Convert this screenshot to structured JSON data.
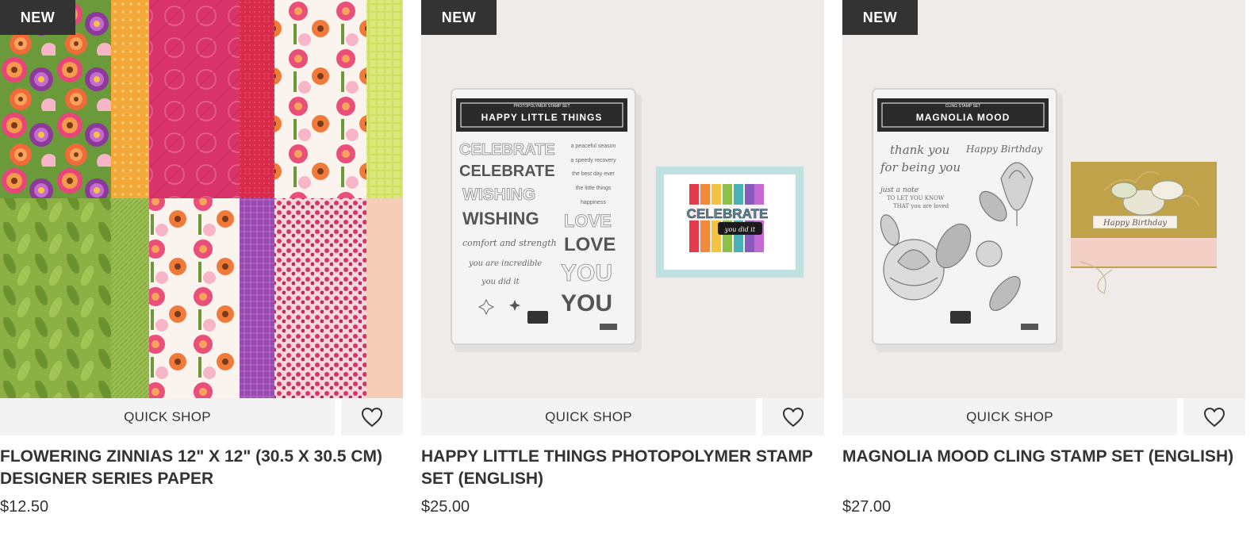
{
  "products": [
    {
      "badge": "NEW",
      "quick_shop_label": "QUICK SHOP",
      "title": "FLOWERING ZINNIAS 12\" X 12\" (30.5 X 30.5 CM) DESIGNER SERIES PAPER",
      "price": "$12.50"
    },
    {
      "badge": "NEW",
      "quick_shop_label": "QUICK SHOP",
      "title": "HAPPY LITTLE THINGS PHOTOPOLYMER STAMP SET (ENGLISH)",
      "price": "$25.00",
      "image_text": {
        "package_title": "HAPPY LITTLE THINGS",
        "package_subtitle": "PHOTOPOLYMER STAMP SET",
        "stamp_words": [
          "CELEBRATE",
          "CELEBRATE",
          "WISHING",
          "WISHING"
        ],
        "stamp_script": [
          "comfort and strength",
          "you are incredible",
          "you did it"
        ],
        "stamp_small": [
          "a peaceful season",
          "a speedy recovery",
          "the best day ever",
          "the little things",
          "happiness"
        ],
        "stamp_words_right": [
          "LOVE",
          "LOVE",
          "YOU",
          "YOU"
        ],
        "card_word": "CELEBRATE",
        "card_script": "you did it"
      }
    },
    {
      "badge": "NEW",
      "quick_shop_label": "QUICK SHOP",
      "title": "MAGNOLIA MOOD CLING STAMP SET (ENGLISH)",
      "price": "$27.00",
      "image_text": {
        "package_title": "MAGNOLIA MOOD",
        "package_subtitle": "CLING STAMP SET",
        "stamp_script": [
          "thank you",
          "for being you",
          "Happy Birthday",
          "just a note"
        ],
        "stamp_small": [
          "TO LET YOU KNOW",
          "THAT you are loved"
        ],
        "card_script": "Happy Birthday"
      }
    }
  ],
  "icons": {
    "favorite": "heart-outline-icon"
  },
  "colors": {
    "badge_bg": "#333333",
    "button_bg": "#f3f3f3",
    "text": "#333333"
  }
}
